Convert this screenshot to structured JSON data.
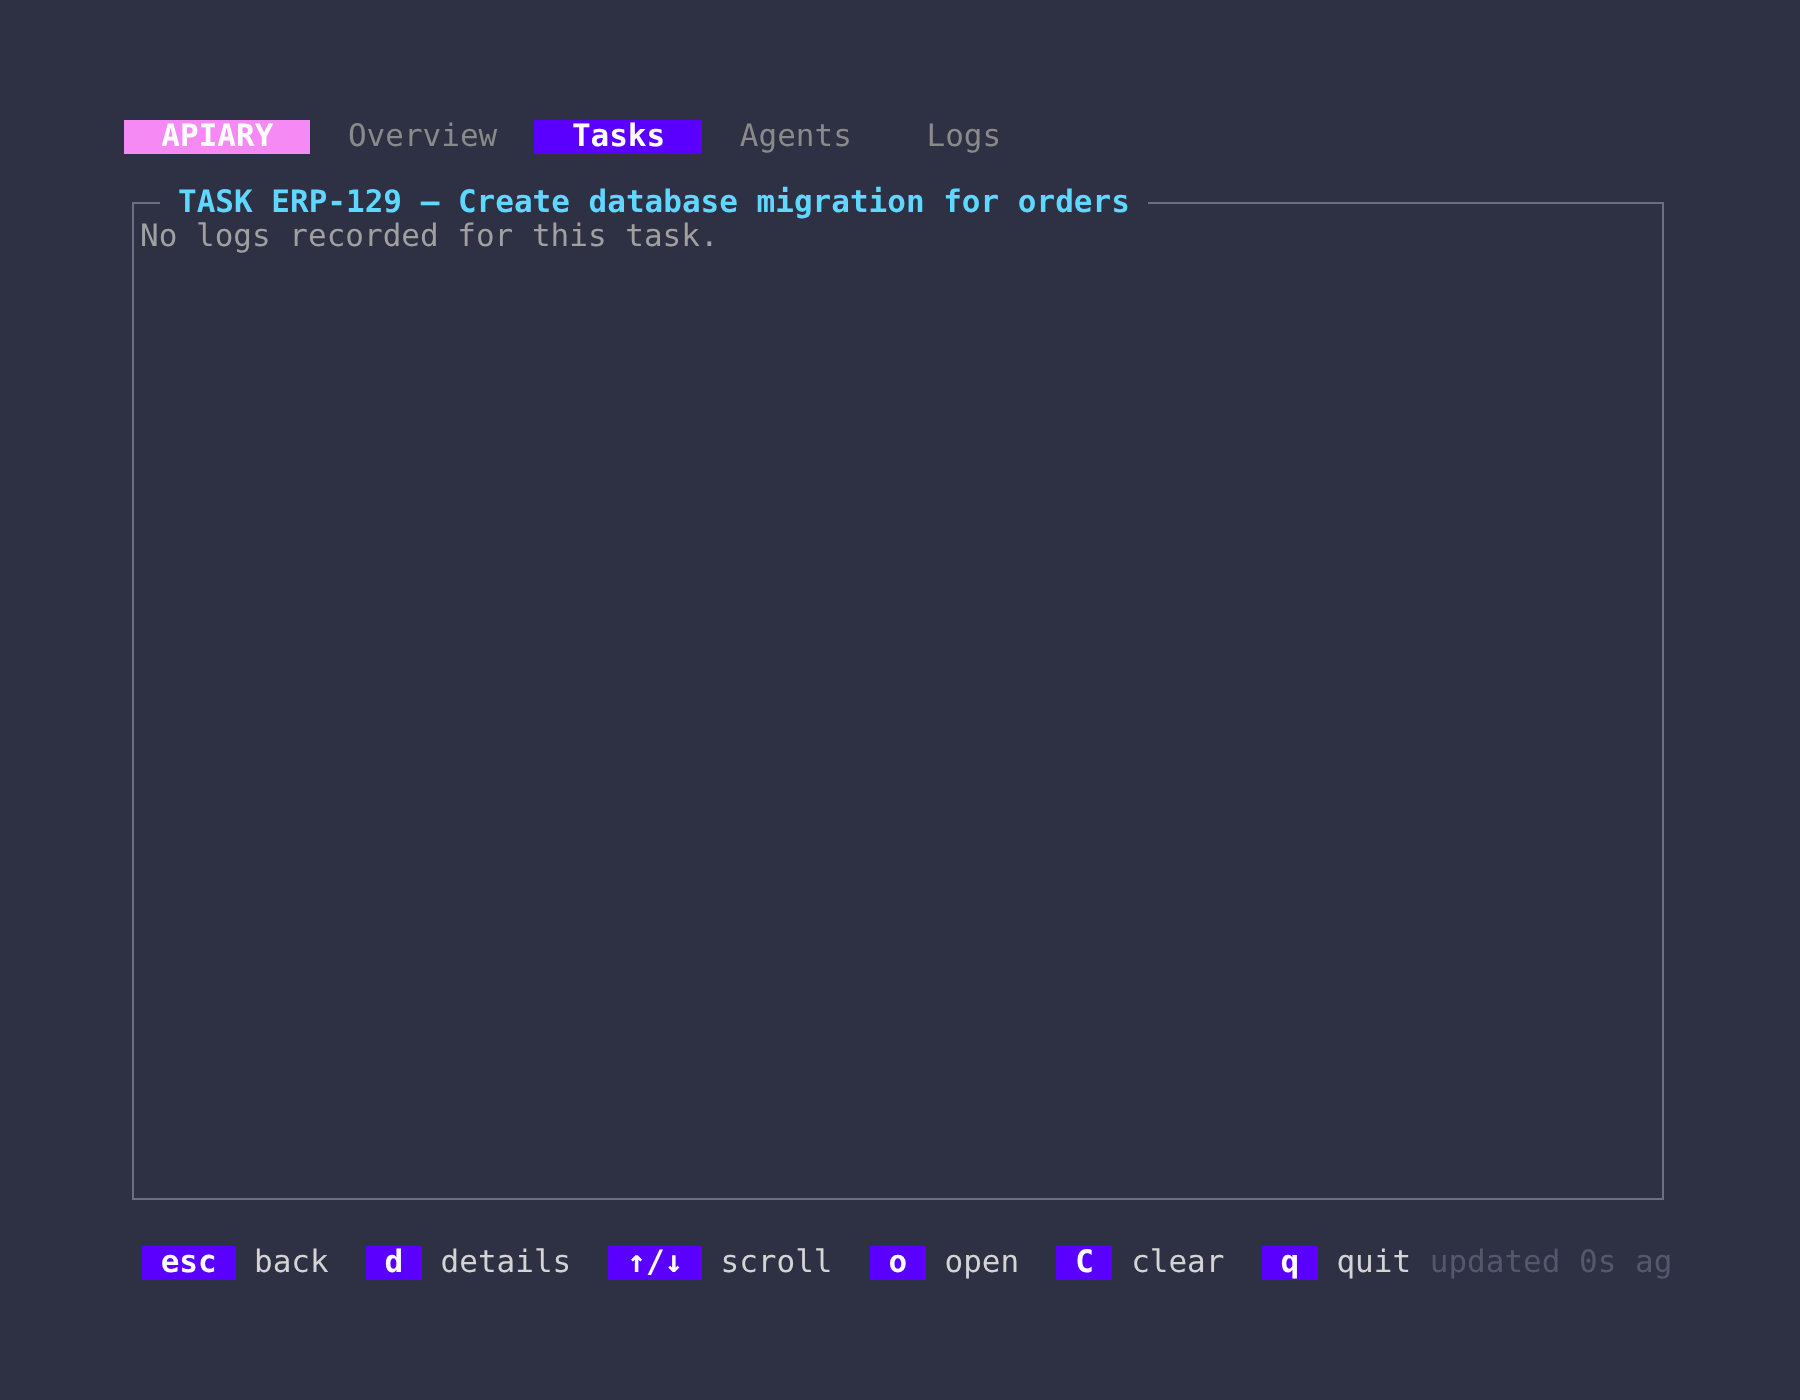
{
  "app_name": "APIARY",
  "tabs": [
    {
      "label": "Overview",
      "selected": false
    },
    {
      "label": "Tasks",
      "selected": true
    },
    {
      "label": "Agents",
      "selected": false
    },
    {
      "label": "Logs",
      "selected": false
    }
  ],
  "panel": {
    "title": "TASK ERP-129 — Create database migration for orders",
    "message": "No logs recorded for this task."
  },
  "footer": {
    "shortcuts": [
      {
        "key": "esc",
        "action": "back"
      },
      {
        "key": "d",
        "action": "details"
      },
      {
        "key": "↑/↓",
        "action": "scroll"
      },
      {
        "key": "o",
        "action": "open"
      },
      {
        "key": "C",
        "action": "clear"
      },
      {
        "key": "q",
        "action": "quit"
      }
    ],
    "status": "updated 0s ag"
  }
}
